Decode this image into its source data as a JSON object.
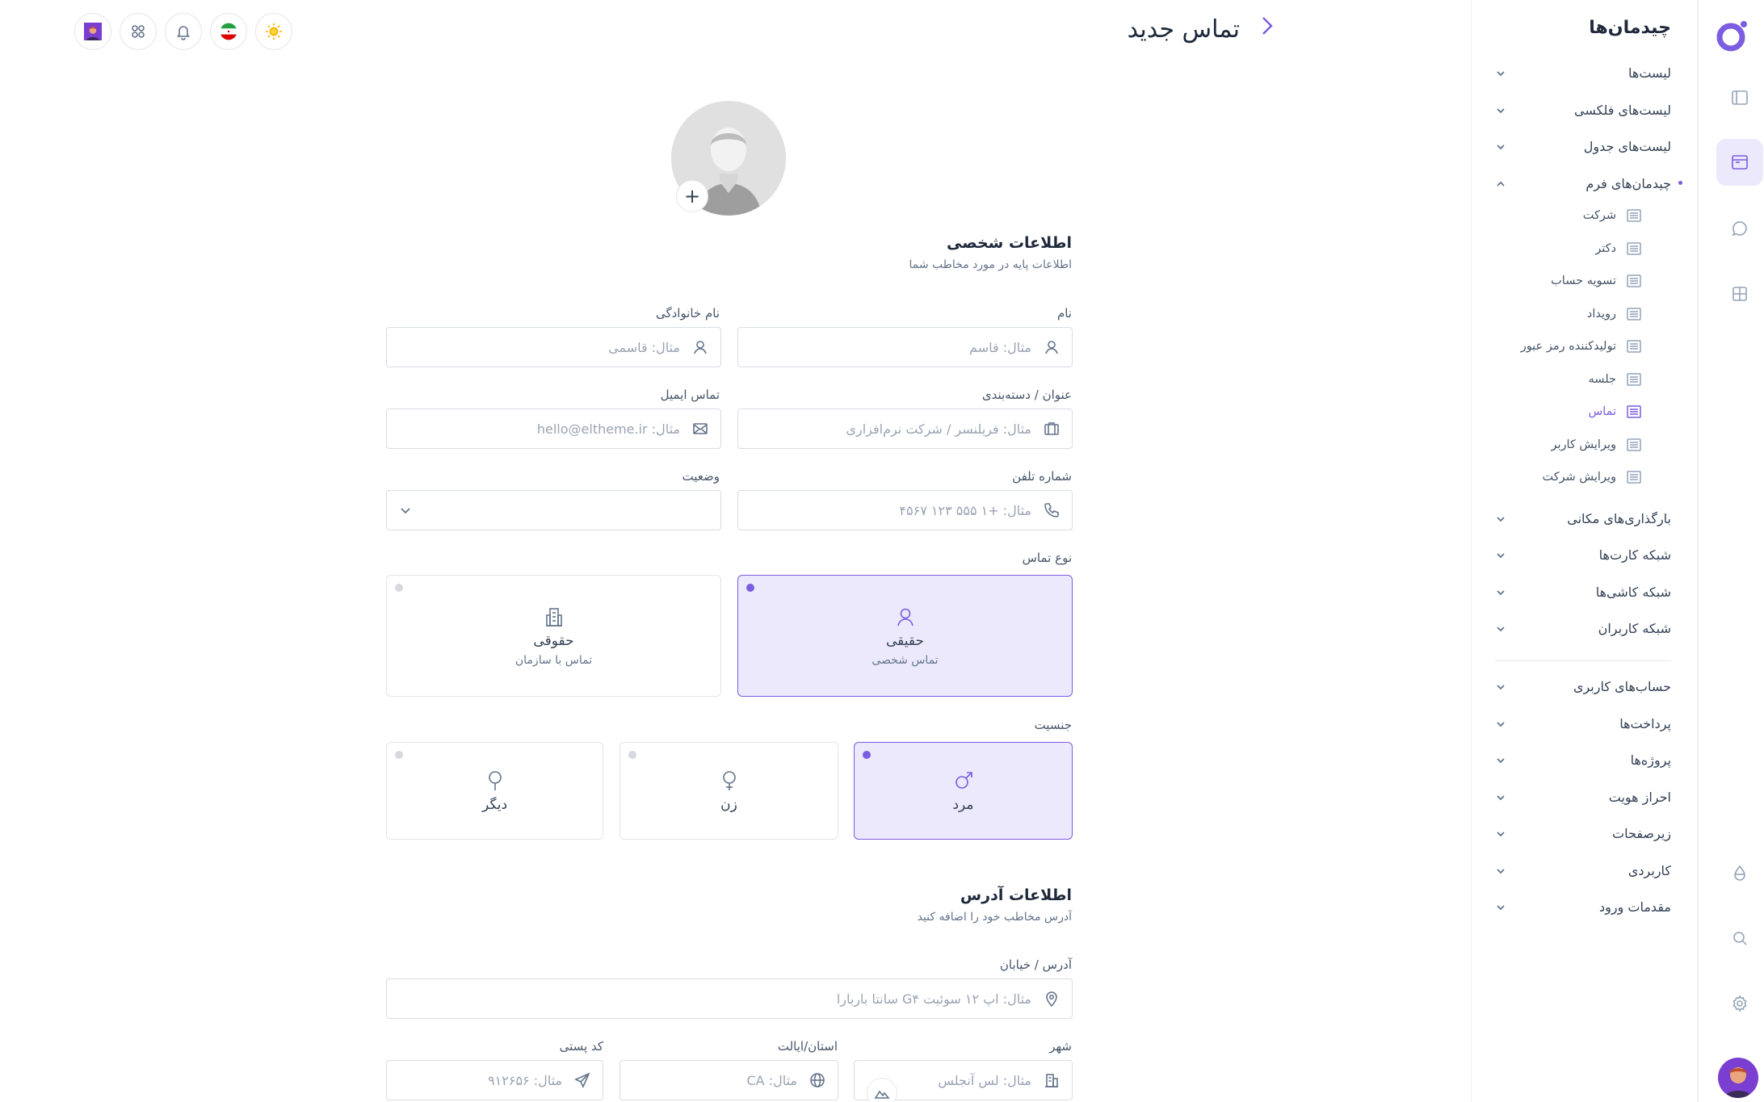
{
  "header": {
    "page_title": "تماس جدید"
  },
  "nav": {
    "title": "چیدمان‌ها",
    "items_top": [
      {
        "label": "لیست‌ها"
      },
      {
        "label": "لیست‌های فلکسی"
      },
      {
        "label": "لیست‌های جدول"
      },
      {
        "label": "چیدمان‌های فرم"
      }
    ],
    "sub_items": [
      {
        "label": "شرکت"
      },
      {
        "label": "دکتر"
      },
      {
        "label": "تسویه حساب"
      },
      {
        "label": "رویداد"
      },
      {
        "label": "تولیدکننده رمز عبور"
      },
      {
        "label": "جلسه"
      },
      {
        "label": "تماس"
      },
      {
        "label": "ویرایش کاربر"
      },
      {
        "label": "ویرایش شرکت"
      }
    ],
    "items_mid": [
      {
        "label": "بارگذاری‌های مکانی"
      },
      {
        "label": "شبکه کارت‌ها"
      },
      {
        "label": "شبکه کاشی‌ها"
      },
      {
        "label": "شبکه کاربران"
      }
    ],
    "items_bottom": [
      {
        "label": "حساب‌های کاربری"
      },
      {
        "label": "پرداخت‌ها"
      },
      {
        "label": "پروژه‌ها"
      },
      {
        "label": "احراز هویت"
      },
      {
        "label": "زیرصفحات"
      },
      {
        "label": "کاربردی"
      },
      {
        "label": "مقدمات ورود"
      }
    ]
  },
  "form": {
    "personal": {
      "title": "اطلاعات شخصی",
      "subtitle": "اطلاعات پایه در مورد مخاطب شما"
    },
    "first_name": {
      "label": "نام",
      "placeholder": "مثال: قاسم"
    },
    "last_name": {
      "label": "نام خانوادگی",
      "placeholder": "مثال: قاسمی"
    },
    "job_title": {
      "label": "عنوان / دسته‌بندی",
      "placeholder": "مثال: فریلنسر / شرکت نرم‌افزاری"
    },
    "email": {
      "label": "تماس ایمیل",
      "placeholder": "مثال: hello@eltheme.ir"
    },
    "phone": {
      "label": "شماره تلفن",
      "placeholder": "مثال: +۱ ۵۵۵ ۱۲۳ ۴۵۶۷"
    },
    "status": {
      "label": "وضعیت",
      "value": ""
    },
    "contact_type": {
      "label": "نوع تماس",
      "options": [
        {
          "title": "حقیقی",
          "sub": "تماس شخصی",
          "icon": "user-icon",
          "selected": true
        },
        {
          "title": "حقوقی",
          "sub": "تماس با سازمان",
          "icon": "building-icon",
          "selected": false
        }
      ]
    },
    "gender": {
      "label": "جنسیت",
      "options": [
        {
          "title": "مرد",
          "icon": "male-icon",
          "selected": true
        },
        {
          "title": "زن",
          "icon": "female-icon",
          "selected": false
        },
        {
          "title": "دیگر",
          "icon": "other-gender-icon",
          "selected": false
        }
      ]
    },
    "address": {
      "title": "اطلاعات آدرس",
      "subtitle": "آدرس مخاطب خود را اضافه کنید"
    },
    "street": {
      "label": "آدرس / خیابان",
      "placeholder": "مثال: اپ ۱۲ سوئیت G۴ سانتا باربارا"
    },
    "city": {
      "label": "شهر",
      "placeholder": "مثال: لس آنجلس"
    },
    "state": {
      "label": "استان/ایالت",
      "placeholder": "مثال: CA"
    },
    "zip": {
      "label": "کد پستی",
      "placeholder": "مثال: ۹۱۲۶۵۶"
    }
  },
  "colors": {
    "accent": "#7c5ce0",
    "accent_bg": "#ece9fc"
  }
}
